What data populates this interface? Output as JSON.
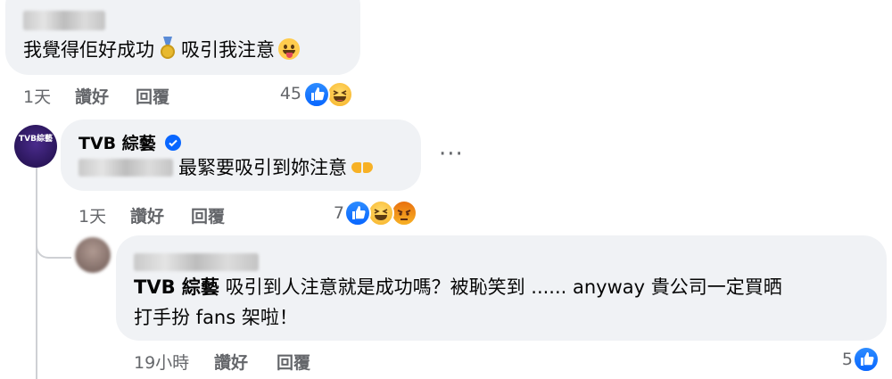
{
  "comment1": {
    "text": "我覺得佢好成功",
    "text2": "吸引我注意",
    "meta": {
      "time": "1天",
      "like": "讚好",
      "reply": "回覆"
    },
    "reaction_count": "45"
  },
  "comment2": {
    "author": "TVB 綜藝",
    "avatar_text": "TVB綜藝",
    "text": "最緊要吸引到妳注意",
    "meta": {
      "time": "1天",
      "like": "讚好",
      "reply": "回覆"
    },
    "reaction_count": "7",
    "more": "···"
  },
  "comment3": {
    "mention": "TVB 綜藝",
    "text": "吸引到人注意就是成功嗎？被恥笑到 ...... anyway 貴公司一定買晒",
    "text2": "打手扮 fans 架啦！",
    "meta": {
      "time": "19小時",
      "like": "讚好",
      "reply": "回覆"
    },
    "reaction_count": "5"
  },
  "colors": {
    "like": "#0866ff",
    "bubble": "#f0f2f5",
    "meta": "#65676b"
  }
}
